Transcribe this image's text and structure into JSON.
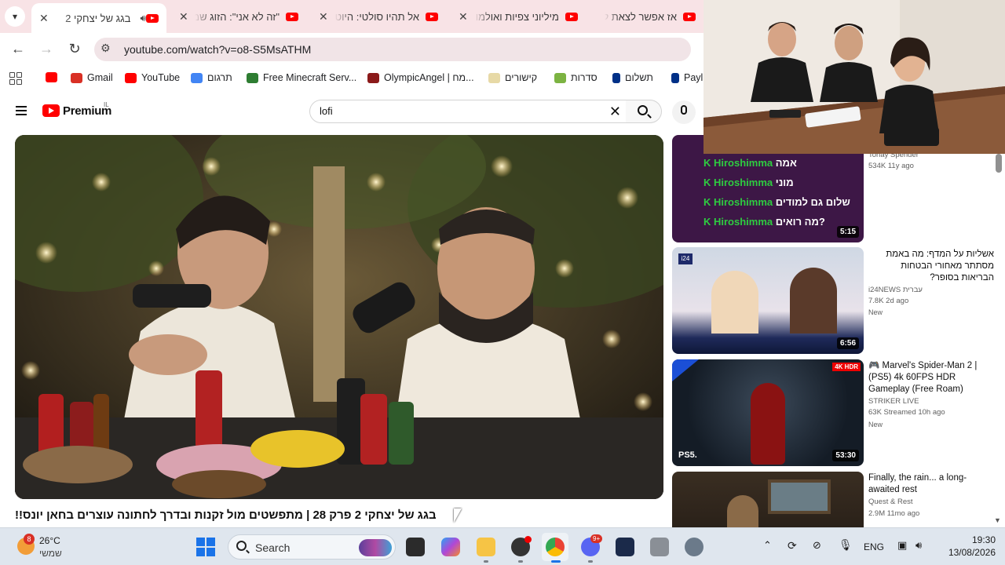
{
  "tabs": [
    {
      "title": "בגג של יצחקי 2",
      "active": true
    },
    {
      "title": "\"זה לא אני\": הזוג שמ",
      "active": false
    },
    {
      "title": "אל תהיו סולטי: היוט",
      "active": false
    },
    {
      "title": "מיליוני צפיות ואולמו",
      "active": false
    },
    {
      "title": "אז אפשר לצאת לפנ",
      "active": false
    }
  ],
  "address": {
    "url": "youtube.com/watch?v=o8-S5MsATHM"
  },
  "bookmarks": [
    {
      "label": "Gmail",
      "color": "#d93025"
    },
    {
      "label": "YouTube",
      "color": "#ff0000"
    },
    {
      "label": "תרגום",
      "color": "#4285f4"
    },
    {
      "label": "Free Minecraft Serv...",
      "color": "#2e7d32"
    },
    {
      "label": "OlympicAngel | מח...",
      "color": "#8b1a1a"
    },
    {
      "label": "קישורים",
      "color": "#c8b16a"
    },
    {
      "label": "סדרות",
      "color": "#7cb342"
    },
    {
      "label": "תשלום",
      "color": "#003087"
    },
    {
      "label": "Payl",
      "color": "#003087"
    }
  ],
  "youtube": {
    "brand": "Premium",
    "country": "IL",
    "search_value": "lofi",
    "video_title": "בגג של יצחקי 2 פרק 28 | מתפשטים מול זקנות ובדרך לחתונה עוצרים בחאן יונס!!"
  },
  "recommendations": [
    {
      "title": "",
      "channel": "Tonay Spender",
      "meta": "534K  11y ago",
      "duration": "5:15",
      "new": ""
    },
    {
      "title": "אשליות על המדף: מה באמת מסתתר מאחורי הבטחות הבריאות בסופר?",
      "channel": "i24NEWS עברית",
      "meta": "7.8K  2d ago",
      "duration": "6:56",
      "new": "New"
    },
    {
      "title": "🎮 Marvel's Spider-Man 2 | (PS5) 4k 60FPS HDR Gameplay (Free Roam)",
      "channel": "STRIKER LIVE",
      "meta": "63K  Streamed 10h ago",
      "duration": "53:30",
      "new": "New"
    },
    {
      "title": "Finally, the rain... a long-awaited rest",
      "channel": "Quest & Rest",
      "meta": "2.9M  11mo ago",
      "duration": "",
      "new": ""
    }
  ],
  "karaoke_lines": [
    {
      "word": "Hiroshimma",
      "tail": "אמה"
    },
    {
      "word": "Hiroshimma",
      "tail": "מוני"
    },
    {
      "word": "Hiroshimma",
      "tail": "שלום גם למודים"
    },
    {
      "word": "Hiroshimma",
      "tail": "מה רואים?"
    }
  ],
  "taskbar": {
    "weather_temp": "26°C",
    "weather_loc": "שמשי",
    "weather_badge": "8",
    "search_label": "Search",
    "discord_badge": "9+",
    "lang": "ENG",
    "time": "19:30",
    "date": "13/08/2026"
  },
  "colors": {
    "accent_red": "#ff0000",
    "tabstrip": "#f8e3e6",
    "taskbar": "#dfe6ee"
  }
}
